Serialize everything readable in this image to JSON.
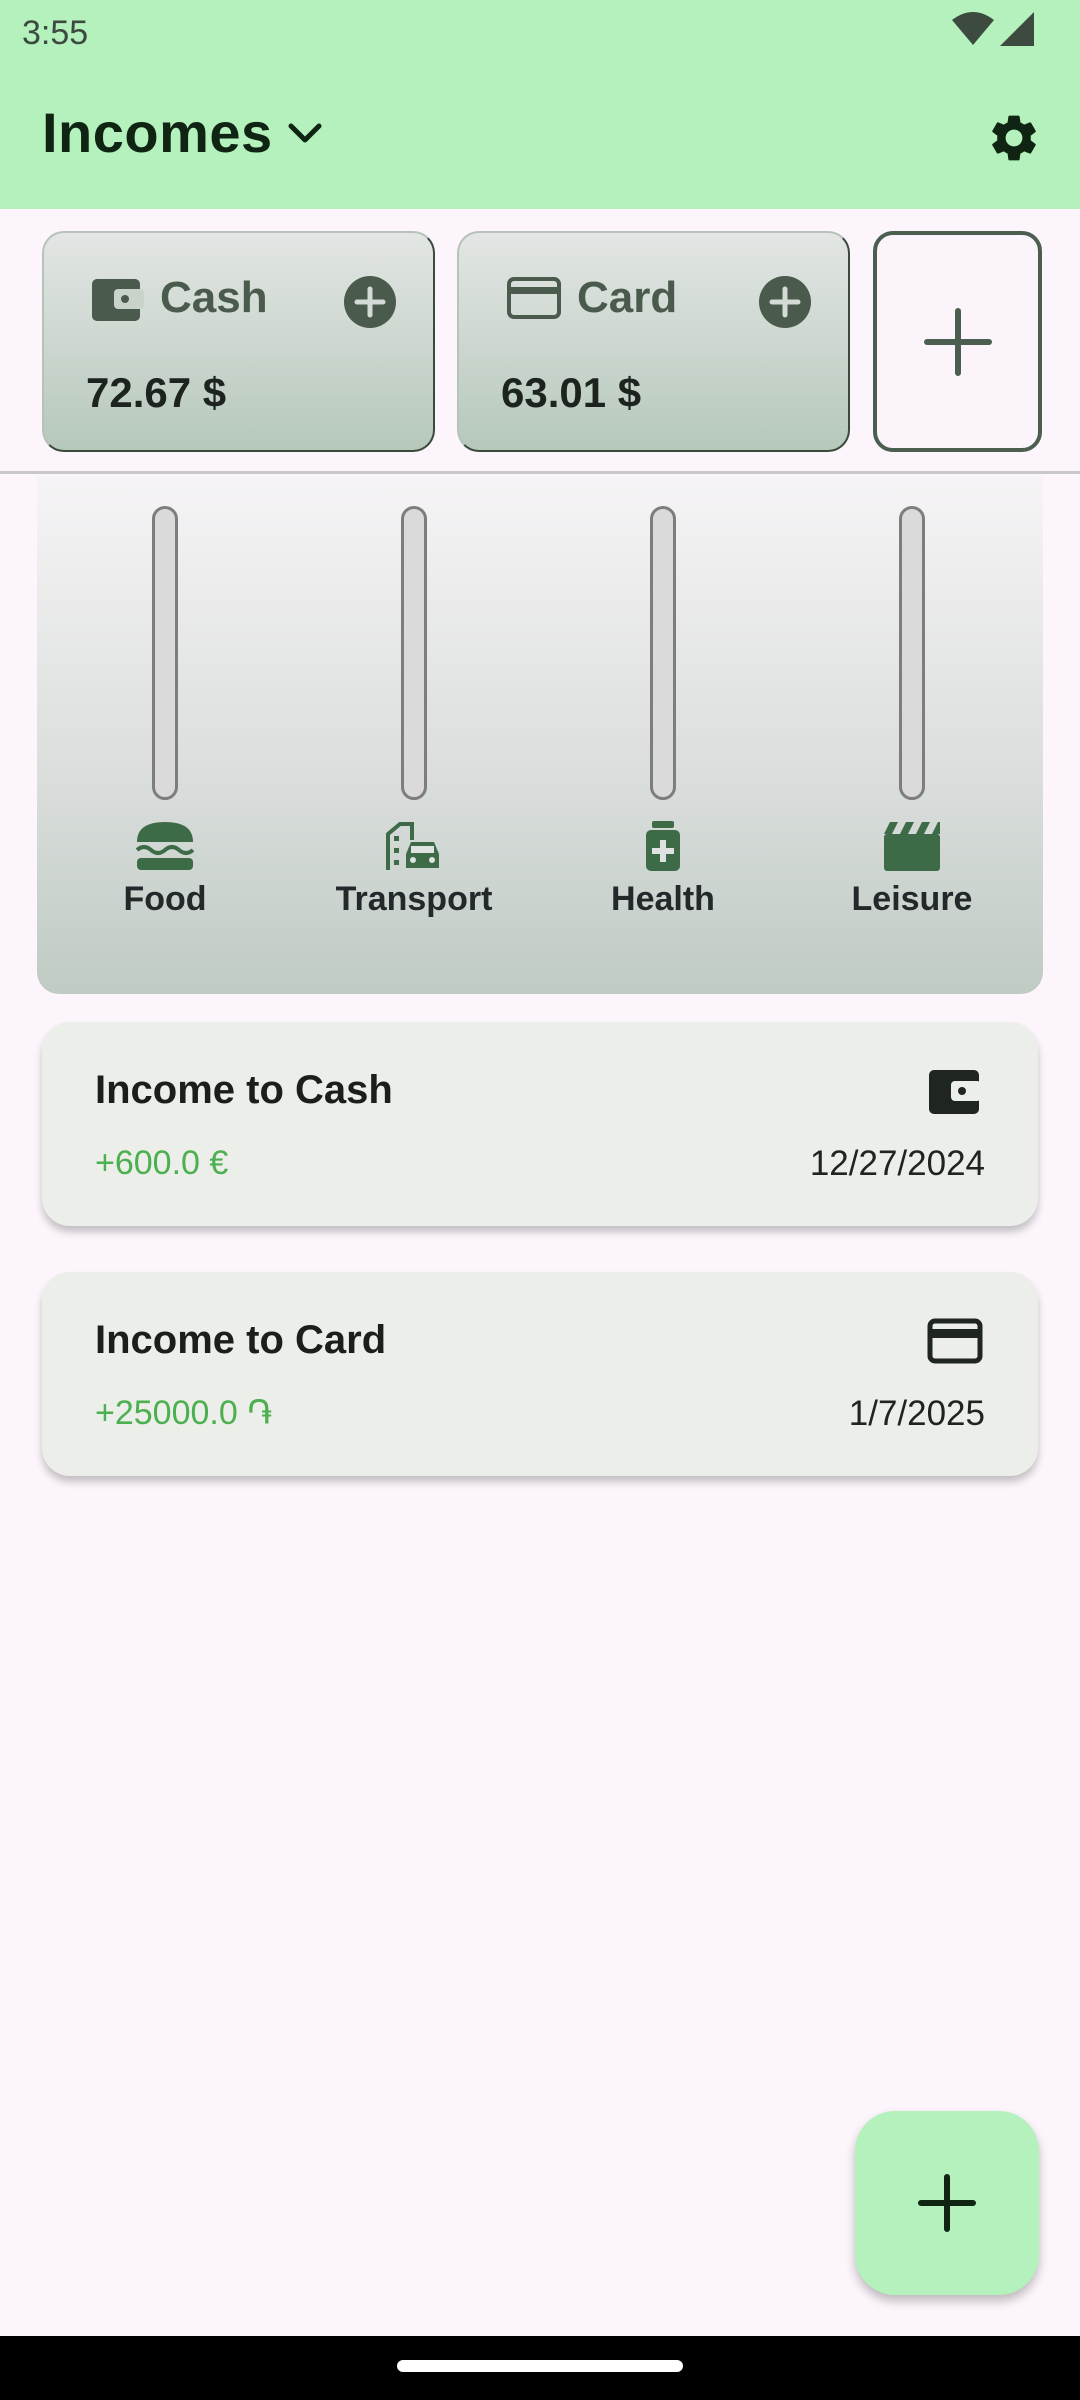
{
  "status_bar": {
    "time": "3:55"
  },
  "app_bar": {
    "title": "Incomes"
  },
  "accounts": [
    {
      "name": "Cash",
      "balance": "72.67 $",
      "icon": "wallet-icon"
    },
    {
      "name": "Card",
      "balance": "63.01 $",
      "icon": "credit-card-icon"
    }
  ],
  "categories": [
    {
      "label": "Food",
      "icon": "burger-icon",
      "fill": 0
    },
    {
      "label": "Transport",
      "icon": "city-car-icon",
      "fill": 0
    },
    {
      "label": "Health",
      "icon": "medicine-icon",
      "fill": 0
    },
    {
      "label": "Leisure",
      "icon": "clapperboard-icon",
      "fill": 0
    }
  ],
  "incomes": [
    {
      "title": "Income to Cash",
      "amount": "+600.0 €",
      "date": "12/27/2024",
      "icon": "wallet-icon"
    },
    {
      "title": "Income to Card",
      "amount": "+25000.0 ֏",
      "date": "1/7/2025",
      "icon": "credit-card-icon"
    }
  ],
  "colors": {
    "app_bar": "#b4f1bd",
    "accent_dark": "#3f5a44",
    "income_positive": "#4caf50",
    "background": "#fcf6fc"
  }
}
